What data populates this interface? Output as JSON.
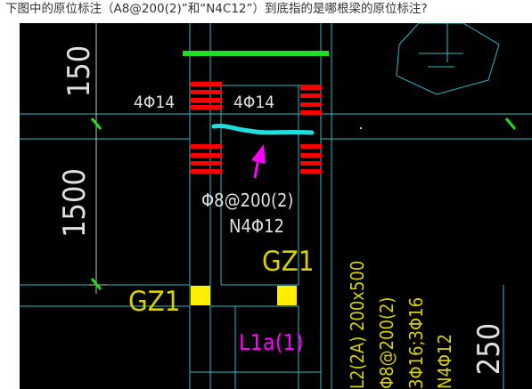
{
  "question": {
    "text": "下图中的原位标注（A8@200(2)”和“N4C12”）到底指的是哪根梁的原位标注?"
  },
  "drawing": {
    "dim_top": "150",
    "dim_mid": "1500",
    "dim_right": "250",
    "rebar_left": "4Φ14",
    "rebar_right": "4Φ14",
    "stirrup": "Φ8@200(2)",
    "waist_bars": "N4Φ12",
    "col_label_right": "GZ1",
    "col_label_left": "GZ1",
    "beam_l1a": "L1a(1)",
    "beam_l2_name": "L2(2A) 200x500",
    "beam_l2_stirrup": "Φ8@200(2)",
    "beam_l2_bars": "3Φ16;3Φ16",
    "beam_l2_waist": "N4Φ12"
  },
  "colors": {
    "background": "#000000",
    "lines_cyan": "#2fb8c8",
    "text_white": "#e0e0e0",
    "text_yellow": "#d8d000",
    "rebar_red": "#ff0000",
    "top_bar_green": "#22dd22",
    "column_yellow": "#ffee00",
    "magenta": "#ff00ff",
    "highlight_cyan": "#22dddd"
  }
}
